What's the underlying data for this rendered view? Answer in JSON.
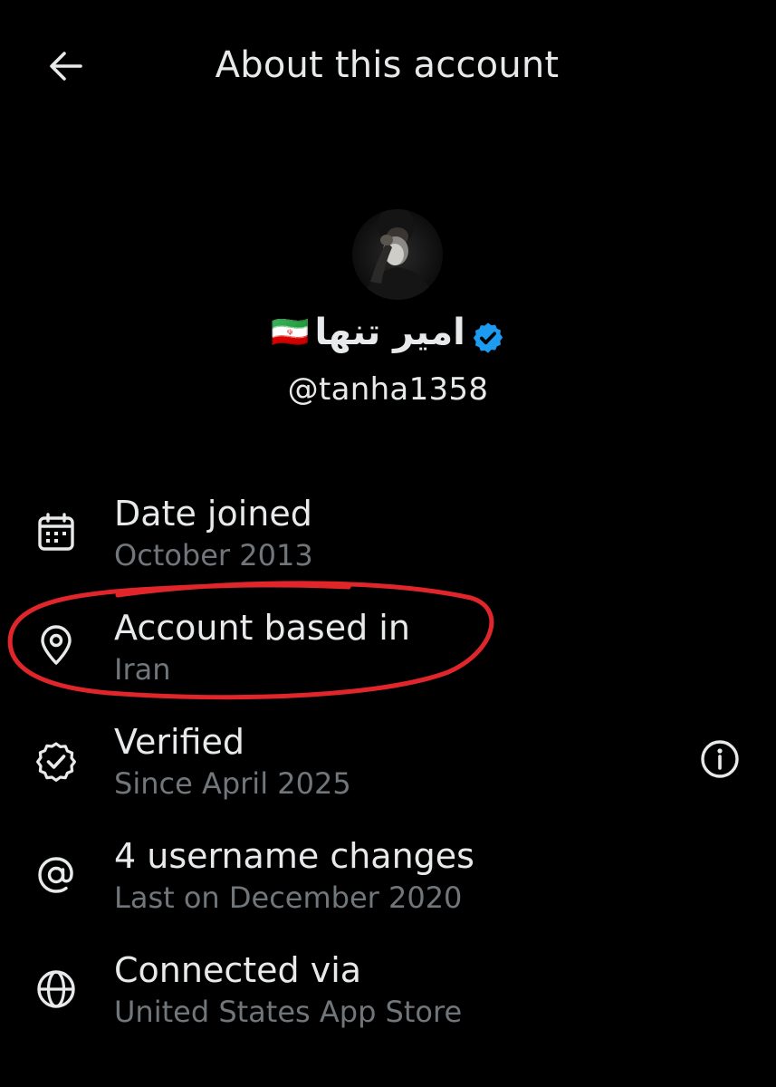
{
  "header": {
    "title": "About this account",
    "back_icon": "arrow-left-icon"
  },
  "profile": {
    "display_name": "امیر تنها",
    "flag": "🇮🇷",
    "handle": "@tanha1358",
    "verified_icon": "verified-badge-icon",
    "badge_color": "#1d9bf0"
  },
  "info_items": [
    {
      "icon": "calendar-icon",
      "title": "Date joined",
      "subtitle": "October 2013"
    },
    {
      "icon": "location-pin-icon",
      "title": "Account based in",
      "subtitle": "Iran"
    },
    {
      "icon": "verified-check-icon",
      "title": "Verified",
      "subtitle": "Since April 2025",
      "action_icon": "info-icon"
    },
    {
      "icon": "at-sign-icon",
      "title": "4 username changes",
      "subtitle": "Last on December 2020"
    },
    {
      "icon": "globe-icon",
      "title": "Connected via",
      "subtitle": "United States App Store"
    }
  ],
  "colors": {
    "background": "#000000",
    "primary_text": "#e7e9ea",
    "secondary_text": "#71767b",
    "annotation": "#e0262b"
  }
}
